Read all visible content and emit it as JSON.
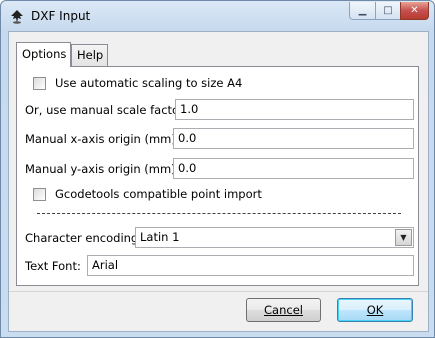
{
  "window": {
    "title": "DXF Input",
    "minimize_glyph": "▁",
    "maximize_glyph": "□",
    "close_glyph": "✕"
  },
  "tabs": [
    {
      "label": "Options",
      "active": true
    },
    {
      "label": "Help",
      "active": false
    }
  ],
  "options": {
    "auto_scale_label": "Use automatic scaling to size A4",
    "auto_scale_checked": false,
    "manual_scale_label": "Or, use manual scale factor:",
    "manual_scale_value": "1.0",
    "x_origin_label": "Manual x-axis origin (mm):",
    "x_origin_value": "0.0",
    "y_origin_label": "Manual y-axis origin (mm):",
    "y_origin_value": "0.0",
    "gcodetools_label": "Gcodetools compatible point import",
    "gcodetools_checked": false,
    "encoding_label": "Character encoding:",
    "encoding_value": "Latin 1",
    "font_label": "Text Font:",
    "font_value": "Arial"
  },
  "buttons": {
    "cancel": "Cancel",
    "ok": "OK"
  }
}
